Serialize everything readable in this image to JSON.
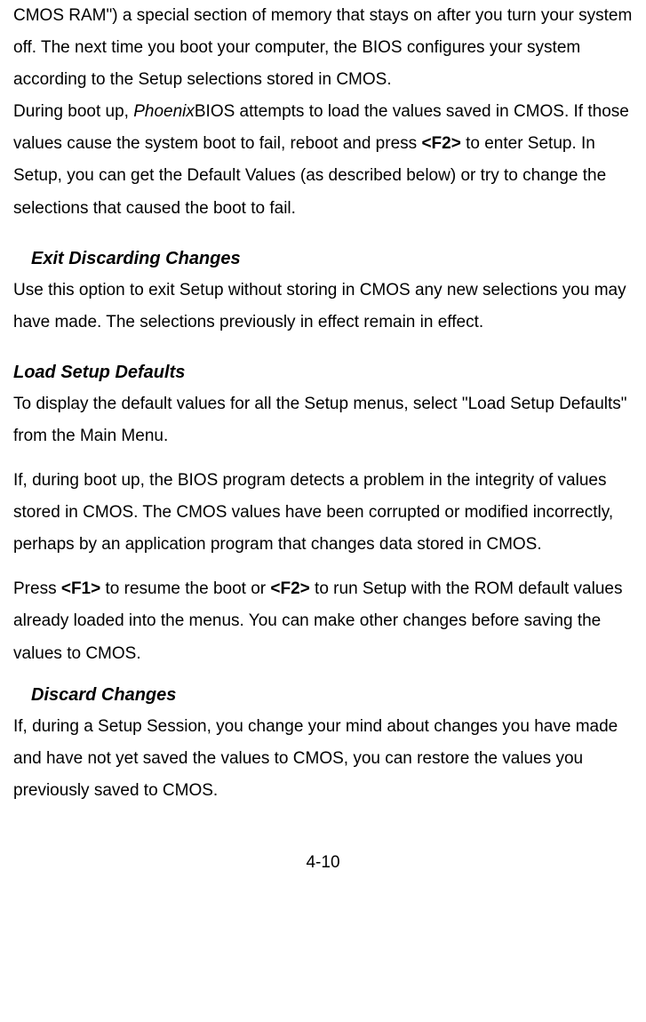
{
  "para1_a": "CMOS RAM\") a special section of memory that stays on after you turn your system off. The next time you boot your computer, the BIOS configures your system according to the Setup selections stored in CMOS.",
  "para2_a": "During boot up, ",
  "para2_phoenix": "Phoenix",
  "para2_b": "BIOS attempts to load the values saved in CMOS. If those values cause the system boot to fail, reboot and press ",
  "para2_f2": "<F2>",
  "para2_c": " to enter Setup. In Setup, you can get the Default Values (as described below) or try to change the selections that caused the boot to fail.",
  "h_exit": "Exit Discarding Changes",
  "para3": "Use this option to exit Setup without storing in CMOS any new selections you may have made. The selections previously in effect remain in effect.",
  "h_load": "Load Setup Defaults",
  "para4": "To display the default values for all the Setup menus, select \"Load Setup Defaults\" from the Main Menu.",
  "para5": "If, during boot up, the BIOS program detects a problem in the integrity of values stored in CMOS. The CMOS values have been corrupted or modified incorrectly, perhaps by an application program that changes data stored in CMOS.",
  "para6_a": "Press ",
  "para6_f1": "<F1>",
  "para6_b": " to resume the boot or ",
  "para6_f2": "<F2>",
  "para6_c": " to run Setup with the ROM default values already loaded into the menus. You can make other changes before saving the values to CMOS.",
  "h_discard": "Discard Changes",
  "para7": "If, during a Setup Session, you change your mind about changes you have made and have not yet saved the values to CMOS, you can restore the values you previously saved to CMOS.",
  "page_num": "4-10"
}
